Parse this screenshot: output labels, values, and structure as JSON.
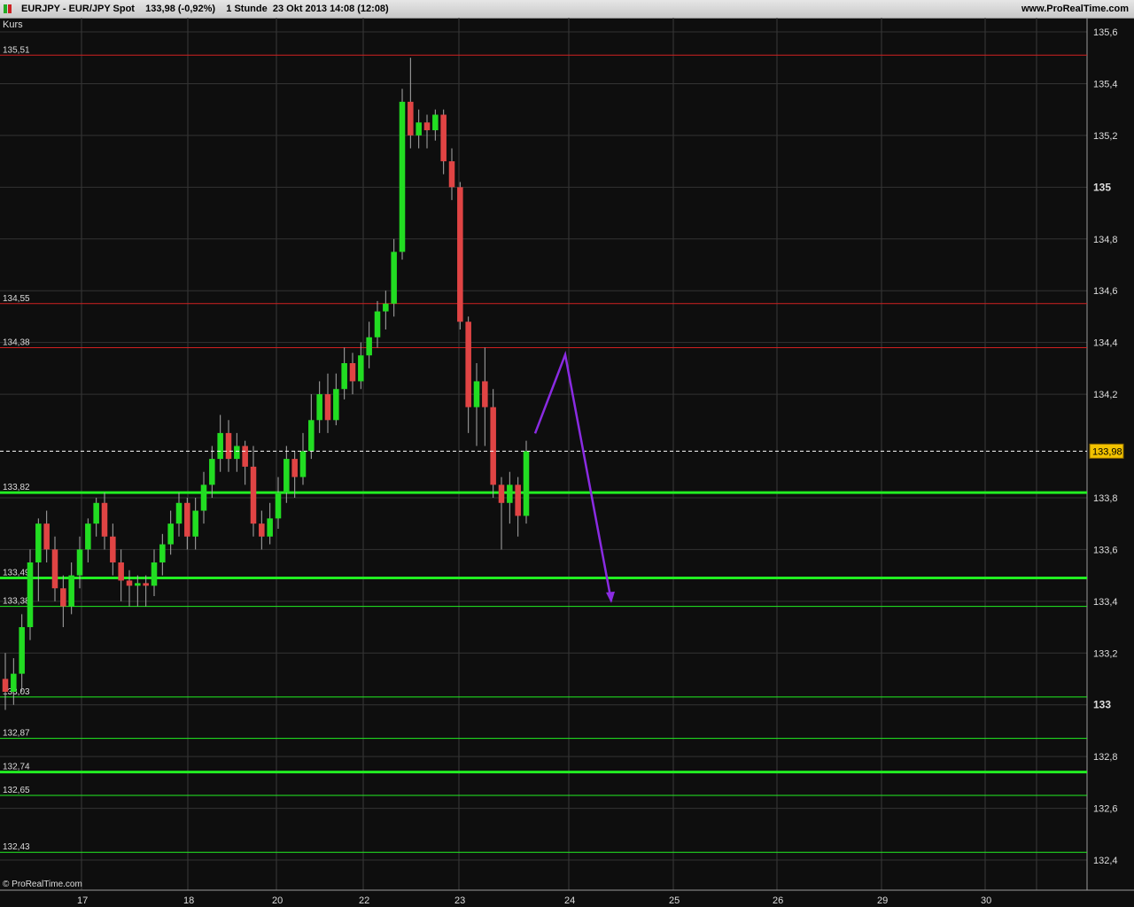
{
  "header": {
    "title": "EURJPY - EUR/JPY Spot    133,98 (-0,92%)    1 Stunde  23 Okt 2013 14:08 (12:08)",
    "site": "www.ProRealTime.com"
  },
  "panel_label": "Kurs",
  "brand": "© ProRealTime.com",
  "colors": {
    "background": "#0e0e0e",
    "up": "#22dd22",
    "down": "#e04444",
    "resistance": "#d02020",
    "support": "#22ee22",
    "arrow": "#8a2be2",
    "price_tag": "#f2c200"
  },
  "chart_data": {
    "type": "candlestick",
    "ylim": [
      132.3,
      135.7
    ],
    "y_ticks": [
      "135,6",
      "135,4",
      "135,2",
      "135",
      "134,8",
      "134,6",
      "134,4",
      "134,2",
      "133,8",
      "133,6",
      "133,4",
      "133,2",
      "133",
      "132,8",
      "132,6",
      "132,4"
    ],
    "y_ticks_values": [
      135.6,
      135.4,
      135.2,
      135.0,
      134.8,
      134.6,
      134.4,
      134.2,
      133.8,
      133.6,
      133.4,
      133.2,
      133.0,
      132.8,
      132.6,
      132.4
    ],
    "x_ticks": [
      "17",
      "18",
      "20",
      "22",
      "23",
      "24",
      "25",
      "26",
      "29",
      "30"
    ],
    "current_price": {
      "label": "133,98",
      "value": 133.98
    },
    "horizontal_levels": [
      {
        "label": "135,51",
        "value": 135.51,
        "color": "red",
        "weight": "thin"
      },
      {
        "label": "134,55",
        "value": 134.55,
        "color": "red",
        "weight": "thin"
      },
      {
        "label": "134,38",
        "value": 134.38,
        "color": "red",
        "weight": "thin"
      },
      {
        "label": "133,82",
        "value": 133.82,
        "color": "green",
        "weight": "thick"
      },
      {
        "label": "133,49",
        "value": 133.49,
        "color": "green",
        "weight": "thick"
      },
      {
        "label": "133,38",
        "value": 133.38,
        "color": "green",
        "weight": "thin"
      },
      {
        "label": "133,03",
        "value": 133.03,
        "color": "green",
        "weight": "thin"
      },
      {
        "label": "132,87",
        "value": 132.87,
        "color": "green",
        "weight": "thin"
      },
      {
        "label": "132,74",
        "value": 132.74,
        "color": "green",
        "weight": "thick"
      },
      {
        "label": "132,65",
        "value": 132.65,
        "color": "green",
        "weight": "thin"
      },
      {
        "label": "132,43",
        "value": 132.43,
        "color": "green",
        "weight": "thin"
      }
    ],
    "candles": [
      [
        133.1,
        133.05,
        133.2,
        132.98
      ],
      [
        133.05,
        133.12,
        133.18,
        133.0
      ],
      [
        133.12,
        133.3,
        133.35,
        133.05
      ],
      [
        133.3,
        133.55,
        133.6,
        133.25
      ],
      [
        133.55,
        133.7,
        133.72,
        133.4
      ],
      [
        133.7,
        133.6,
        133.75,
        133.55
      ],
      [
        133.6,
        133.45,
        133.65,
        133.4
      ],
      [
        133.45,
        133.38,
        133.5,
        133.3
      ],
      [
        133.38,
        133.5,
        133.55,
        133.35
      ],
      [
        133.5,
        133.6,
        133.65,
        133.45
      ],
      [
        133.6,
        133.7,
        133.72,
        133.55
      ],
      [
        133.7,
        133.78,
        133.8,
        133.65
      ],
      [
        133.78,
        133.65,
        133.82,
        133.6
      ],
      [
        133.65,
        133.55,
        133.7,
        133.5
      ],
      [
        133.55,
        133.48,
        133.6,
        133.4
      ],
      [
        133.48,
        133.46,
        133.52,
        133.38
      ],
      [
        133.46,
        133.47,
        133.5,
        133.38
      ],
      [
        133.47,
        133.46,
        133.5,
        133.38
      ],
      [
        133.46,
        133.55,
        133.6,
        133.42
      ],
      [
        133.55,
        133.62,
        133.66,
        133.5
      ],
      [
        133.62,
        133.7,
        133.75,
        133.58
      ],
      [
        133.7,
        133.78,
        133.82,
        133.65
      ],
      [
        133.78,
        133.65,
        133.8,
        133.6
      ],
      [
        133.65,
        133.75,
        133.8,
        133.6
      ],
      [
        133.75,
        133.85,
        133.9,
        133.7
      ],
      [
        133.85,
        133.95,
        134.0,
        133.8
      ],
      [
        133.95,
        134.05,
        134.12,
        133.9
      ],
      [
        134.05,
        133.95,
        134.1,
        133.9
      ],
      [
        133.95,
        134.0,
        134.05,
        133.9
      ],
      [
        134.0,
        133.92,
        134.02,
        133.85
      ],
      [
        133.92,
        133.7,
        134.0,
        133.65
      ],
      [
        133.7,
        133.65,
        133.75,
        133.6
      ],
      [
        133.65,
        133.72,
        133.78,
        133.62
      ],
      [
        133.72,
        133.82,
        133.88,
        133.68
      ],
      [
        133.82,
        133.95,
        134.0,
        133.78
      ],
      [
        133.95,
        133.88,
        133.98,
        133.8
      ],
      [
        133.88,
        133.98,
        134.05,
        133.85
      ],
      [
        133.98,
        134.1,
        134.2,
        133.95
      ],
      [
        134.1,
        134.2,
        134.25,
        134.05
      ],
      [
        134.2,
        134.1,
        134.28,
        134.05
      ],
      [
        134.1,
        134.22,
        134.28,
        134.08
      ],
      [
        134.22,
        134.32,
        134.38,
        134.18
      ],
      [
        134.32,
        134.25,
        134.36,
        134.2
      ],
      [
        134.25,
        134.35,
        134.4,
        134.22
      ],
      [
        134.35,
        134.42,
        134.48,
        134.3
      ],
      [
        134.42,
        134.52,
        134.56,
        134.38
      ],
      [
        134.52,
        134.55,
        134.6,
        134.45
      ],
      [
        134.55,
        134.75,
        134.8,
        134.5
      ],
      [
        134.75,
        135.33,
        135.38,
        134.72
      ],
      [
        135.33,
        135.2,
        135.5,
        135.15
      ],
      [
        135.2,
        135.25,
        135.3,
        135.15
      ],
      [
        135.25,
        135.22,
        135.28,
        135.15
      ],
      [
        135.22,
        135.28,
        135.3,
        135.18
      ],
      [
        135.28,
        135.1,
        135.3,
        135.05
      ],
      [
        135.1,
        135.0,
        135.15,
        134.95
      ],
      [
        135.0,
        134.48,
        135.02,
        134.45
      ],
      [
        134.48,
        134.15,
        134.5,
        134.05
      ],
      [
        134.15,
        134.25,
        134.32,
        134.0
      ],
      [
        134.25,
        134.15,
        134.38,
        134.0
      ],
      [
        134.15,
        133.85,
        134.22,
        133.8
      ],
      [
        133.85,
        133.78,
        133.88,
        133.6
      ],
      [
        133.78,
        133.85,
        133.9,
        133.7
      ],
      [
        133.85,
        133.73,
        133.88,
        133.65
      ],
      [
        133.73,
        133.98,
        134.02,
        133.7
      ]
    ],
    "annotations": [
      {
        "type": "arrow",
        "path": [
          [
            133.98,
            134.05
          ],
          [
            134.38,
            134.38
          ],
          [
            133.38,
            133.4
          ]
        ]
      }
    ]
  }
}
